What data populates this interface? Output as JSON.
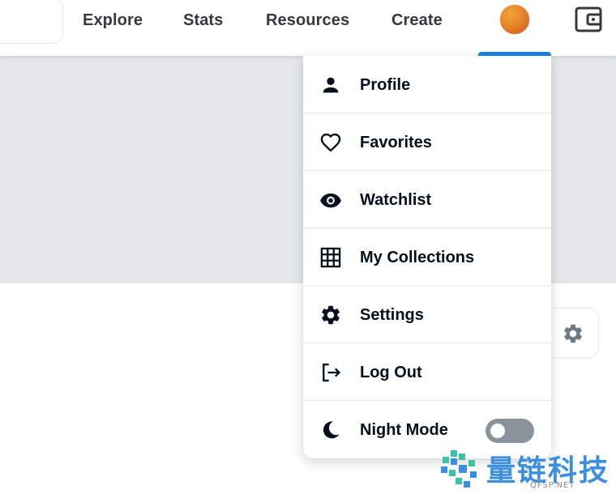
{
  "nav": {
    "links": [
      "Explore",
      "Stats",
      "Resources",
      "Create"
    ],
    "avatar_icon": "user-avatar",
    "wallet_icon": "wallet-icon"
  },
  "menu": {
    "items": [
      {
        "label": "Profile",
        "icon": "person-icon"
      },
      {
        "label": "Favorites",
        "icon": "heart-icon"
      },
      {
        "label": "Watchlist",
        "icon": "eye-icon"
      },
      {
        "label": "My Collections",
        "icon": "grid-icon"
      },
      {
        "label": "Settings",
        "icon": "gear-icon"
      },
      {
        "label": "Log Out",
        "icon": "logout-icon"
      },
      {
        "label": "Night Mode",
        "icon": "moon-icon"
      }
    ],
    "night_mode_enabled": false
  },
  "watermark": {
    "text": "量链科技",
    "sub": "QFSP.NET"
  },
  "colors": {
    "accent": "#2081e2",
    "banner": "#e5e8eb",
    "text": "#04111d",
    "nav_text": "#353840",
    "toggle_off": "#8a939b",
    "watermark": "#3c8ee0"
  }
}
